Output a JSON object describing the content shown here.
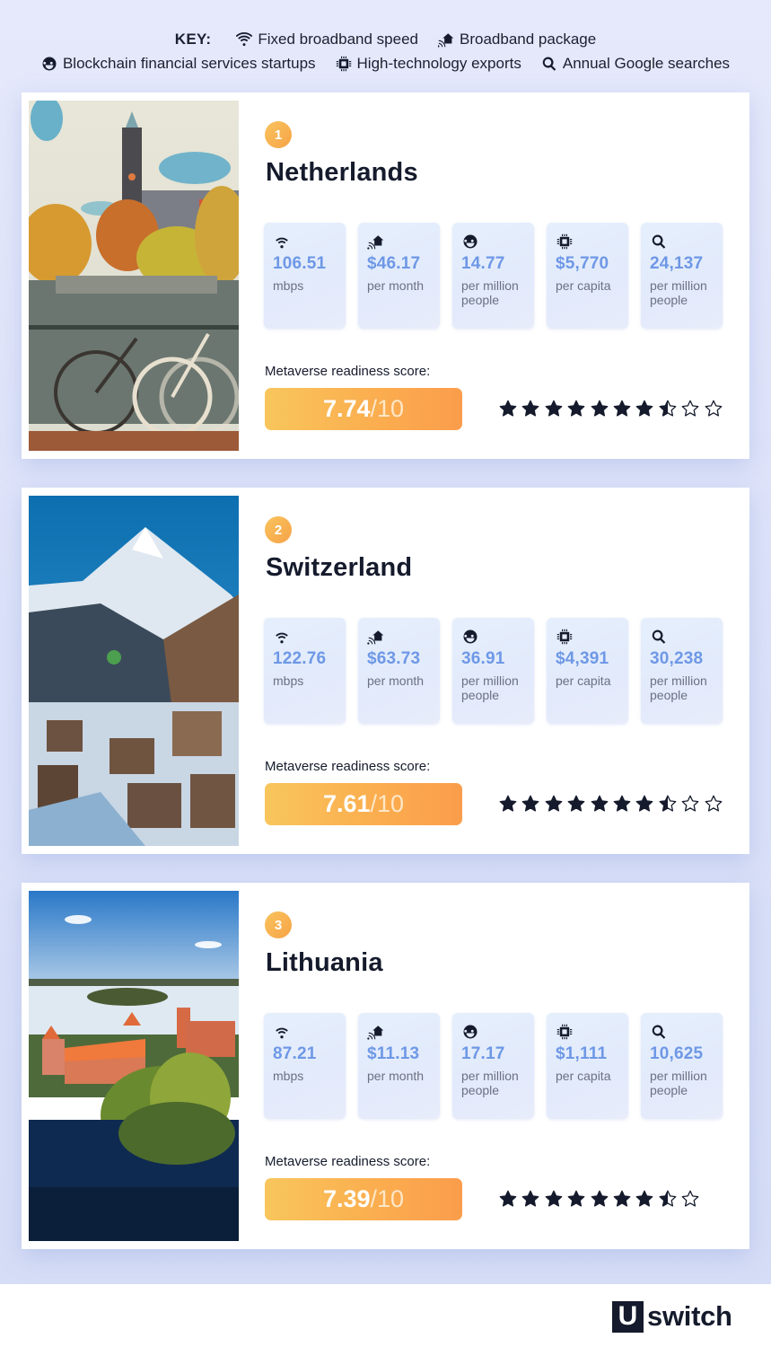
{
  "key": {
    "title": "KEY:",
    "items": [
      {
        "icon": "wifi-icon",
        "label": "Fixed broadband speed"
      },
      {
        "icon": "broadband-house-icon",
        "label": "Broadband package"
      },
      {
        "icon": "blockchain-icon",
        "label": "Blockchain financial services startups"
      },
      {
        "icon": "chip-icon",
        "label": "High-technology exports"
      },
      {
        "icon": "search-icon",
        "label": "Annual Google searches"
      }
    ]
  },
  "score_label": "Metaverse readiness score:",
  "score_max": "/10",
  "countries": [
    {
      "rank": "1",
      "name": "Netherlands",
      "photo": "amsterdam-canal-photo",
      "stats": [
        {
          "icon": "wifi-icon",
          "value": "106.51",
          "unit": "mbps"
        },
        {
          "icon": "broadband-house-icon",
          "value": "$46.17",
          "unit": "per month"
        },
        {
          "icon": "blockchain-icon",
          "value": "14.77",
          "unit": "per million people"
        },
        {
          "icon": "chip-icon",
          "value": "$5,770",
          "unit": "per capita"
        },
        {
          "icon": "search-icon",
          "value": "24,137",
          "unit": "per million people"
        }
      ],
      "score": "7.74",
      "stars": {
        "full": 7,
        "half": 1,
        "empty": 2
      }
    },
    {
      "rank": "2",
      "name": "Switzerland",
      "photo": "matterhorn-village-photo",
      "stats": [
        {
          "icon": "wifi-icon",
          "value": "122.76",
          "unit": "mbps"
        },
        {
          "icon": "broadband-house-icon",
          "value": "$63.73",
          "unit": "per month"
        },
        {
          "icon": "blockchain-icon",
          "value": "36.91",
          "unit": "per million people"
        },
        {
          "icon": "chip-icon",
          "value": "$4,391",
          "unit": "per capita"
        },
        {
          "icon": "search-icon",
          "value": "30,238",
          "unit": "per million people"
        }
      ],
      "score": "7.61",
      "stars": {
        "full": 7,
        "half": 1,
        "empty": 2
      }
    },
    {
      "rank": "3",
      "name": "Lithuania",
      "photo": "trakai-castle-photo",
      "stats": [
        {
          "icon": "wifi-icon",
          "value": "87.21",
          "unit": "mbps"
        },
        {
          "icon": "broadband-house-icon",
          "value": "$11.13",
          "unit": "per month"
        },
        {
          "icon": "blockchain-icon",
          "value": "17.17",
          "unit": "per million people"
        },
        {
          "icon": "chip-icon",
          "value": "$1,111",
          "unit": "per capita"
        },
        {
          "icon": "search-icon",
          "value": "10,625",
          "unit": "per million people"
        }
      ],
      "score": "7.39",
      "stars": {
        "full": 7,
        "half": 1,
        "empty": 1
      }
    }
  ],
  "brand": {
    "mark": "U",
    "word": "switch"
  },
  "colors": {
    "accent_value": "#6e98e6",
    "score_gradient_start": "#f8c65c",
    "score_gradient_end": "#fb9d4c",
    "dark": "#151b2c"
  }
}
